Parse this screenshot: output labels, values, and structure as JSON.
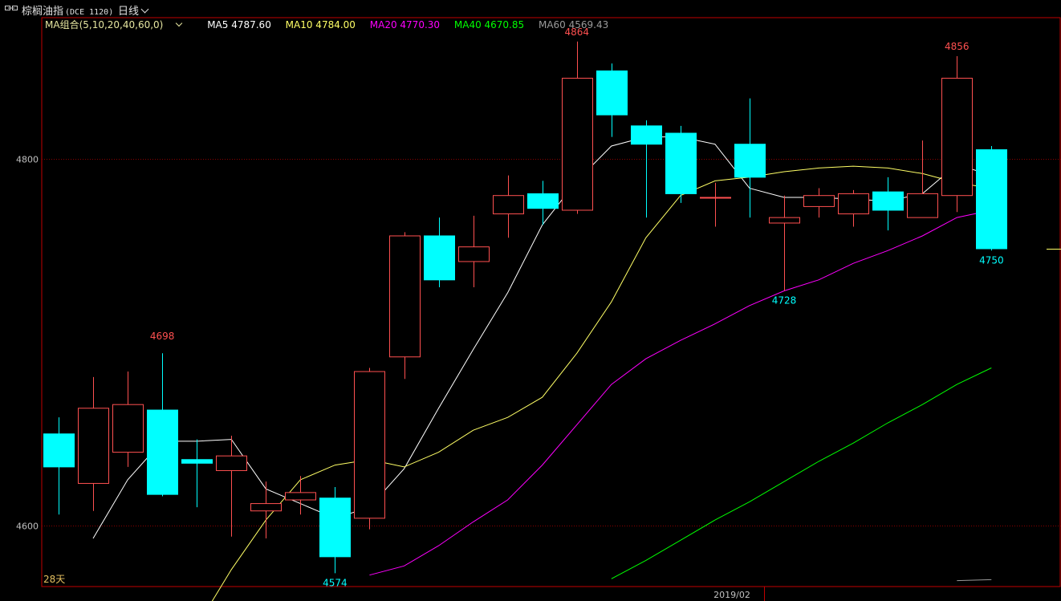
{
  "header": {
    "title": "棕榈油指",
    "code": "(DCE 1120)",
    "period": "日线"
  },
  "legend": {
    "combo": "MA组合(5,10,20,40,60,0)",
    "ma5": "MA5 4787.60",
    "ma10": "MA10 4784.00",
    "ma20": "MA20 4770.30",
    "ma40": "MA40 4670.85",
    "ma60": "MA60 4569.43"
  },
  "colors": {
    "up": "#ff5050",
    "down": "#00ffff",
    "ma5": "#ffffff",
    "ma10": "#ffff66",
    "ma20": "#ff00ff",
    "ma40": "#00ff00",
    "ma60": "#9a9a9a",
    "grid": "#8b0000",
    "axis": "#c00000"
  },
  "footer": {
    "days": "28天",
    "date": "2019/02"
  },
  "chart_data": {
    "type": "candlestick",
    "title": "棕榈油指 (DCE 1120) 日线",
    "ylim": [
      4570,
      4805
    ],
    "y_ticks": [
      4600,
      4800
    ],
    "candles": [
      {
        "open": 4650,
        "high": 4659,
        "low": 4606,
        "close": 4632
      },
      {
        "open": 4623,
        "high": 4681,
        "low": 4608,
        "close": 4664
      },
      {
        "open": 4640,
        "high": 4684,
        "low": 4632,
        "close": 4666
      },
      {
        "open": 4663,
        "high": 4694,
        "low": 4616,
        "close": 4617
      },
      {
        "open": 4636,
        "high": 4647,
        "low": 4610,
        "close": 4634
      },
      {
        "open": 4630,
        "high": 4649,
        "low": 4594,
        "close": 4638
      },
      {
        "open": 4608,
        "high": 4624,
        "low": 4593,
        "close": 4612
      },
      {
        "open": 4614,
        "high": 4627,
        "low": 4606,
        "close": 4618
      },
      {
        "open": 4615,
        "high": 4621,
        "low": 4574,
        "close": 4583
      },
      {
        "open": 4604,
        "high": 4686,
        "low": 4598,
        "close": 4684
      },
      {
        "open": 4692,
        "high": 4760,
        "low": 4680,
        "close": 4758
      },
      {
        "open": 4758,
        "high": 4768,
        "low": 4730,
        "close": 4734
      },
      {
        "open": 4744,
        "high": 4769,
        "low": 4730,
        "close": 4752
      },
      {
        "open": 4770,
        "high": 4791,
        "low": 4757,
        "close": 4780
      },
      {
        "open": 4781,
        "high": 4788,
        "low": 4764,
        "close": 4773
      },
      {
        "open": 4772,
        "high": 4864,
        "low": 4770,
        "close": 4844
      },
      {
        "open": 4848,
        "high": 4852,
        "low": 4812,
        "close": 4824
      },
      {
        "open": 4818,
        "high": 4821,
        "low": 4768,
        "close": 4808
      },
      {
        "open": 4814,
        "high": 4818,
        "low": 4776,
        "close": 4781
      },
      {
        "open": 4779,
        "high": 4787,
        "low": 4763,
        "close": 4779
      },
      {
        "open": 4808,
        "high": 4833,
        "low": 4768,
        "close": 4790
      },
      {
        "open": 4765,
        "high": 4780,
        "low": 4728,
        "close": 4768
      },
      {
        "open": 4774,
        "high": 4784,
        "low": 4768,
        "close": 4780
      },
      {
        "open": 4770,
        "high": 4783,
        "low": 4763,
        "close": 4781
      },
      {
        "open": 4782,
        "high": 4790,
        "low": 4761,
        "close": 4772
      },
      {
        "open": 4768,
        "high": 4810,
        "low": 4768,
        "close": 4781
      },
      {
        "open": 4780,
        "high": 4856,
        "low": 4771,
        "close": 4844
      },
      {
        "open": 4805,
        "high": 4807,
        "low": 4750,
        "close": 4751
      }
    ],
    "ma5": [
      4593,
      4625,
      4646,
      4646,
      4647,
      4620,
      4612,
      4604,
      4610,
      4631,
      4664,
      4696,
      4727,
      4764,
      4788,
      4807,
      4812,
      4812,
      4808,
      4784,
      4779,
      4779,
      4778,
      4777,
      4781,
      4797,
      4791
    ],
    "ma10": [
      4545,
      4576,
      4603,
      4625,
      4633,
      4636,
      4632,
      4640,
      4652,
      4659,
      4670,
      4694,
      4722,
      4757,
      4780,
      4788,
      4790,
      4793,
      4795,
      4796,
      4795,
      4792,
      4787,
      4784
    ],
    "ma20": [
      4573,
      4578,
      4589,
      4602,
      4614,
      4633,
      4655,
      4677,
      4691,
      4701,
      4710,
      4720,
      4728,
      4734,
      4743,
      4750,
      4758,
      4768,
      4772
    ],
    "ma40": [
      4571,
      4581,
      4592,
      4603,
      4613,
      4624,
      4635,
      4645,
      4656,
      4666,
      4677,
      4686
    ],
    "ma60": [
      4570,
      4570.5
    ],
    "annotations": [
      {
        "index": 3,
        "value": 4698,
        "pos": "above",
        "color": "#ff5050"
      },
      {
        "index": 8,
        "value": 4574,
        "pos": "below",
        "color": "#00ffff"
      },
      {
        "index": 15,
        "value": 4864,
        "pos": "above",
        "color": "#ff5050"
      },
      {
        "index": 21,
        "value": 4728,
        "pos": "below",
        "color": "#00ffff"
      },
      {
        "index": 26,
        "value": 4856,
        "pos": "above",
        "color": "#ff5050"
      },
      {
        "index": 27,
        "value": 4750,
        "pos": "below",
        "color": "#00ffff"
      }
    ],
    "x_tick": "2019/02"
  }
}
